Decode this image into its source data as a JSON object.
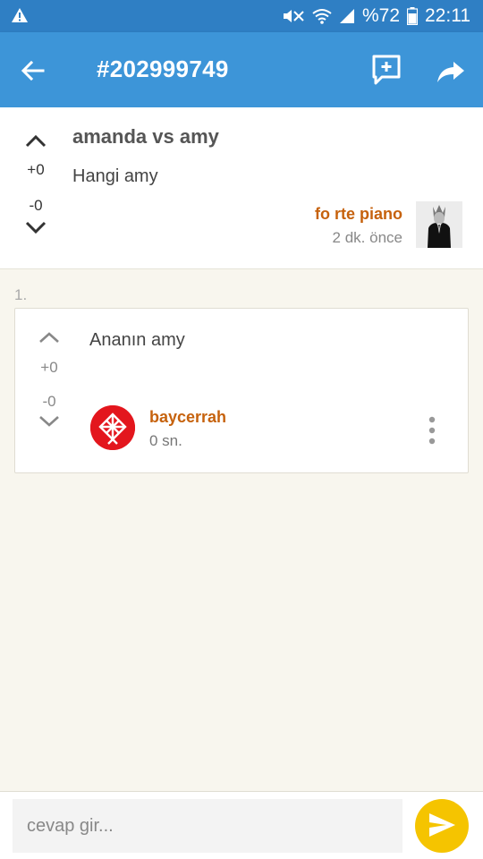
{
  "status_bar": {
    "battery": "%72",
    "time": "22:11",
    "icons": [
      "warning-icon",
      "mute-icon",
      "wifi-icon",
      "signal-icon",
      "battery-icon"
    ]
  },
  "app_bar": {
    "title": "#202999749",
    "icons": [
      "back-arrow-icon",
      "add-entry-icon",
      "share-icon"
    ]
  },
  "topic": {
    "title": "amanda vs amy",
    "body": "Hangi amy",
    "upvotes": "+0",
    "downvotes": "-0",
    "author": "fo rte piano",
    "time": "2 dk. önce"
  },
  "entries": [
    {
      "index": "1.",
      "body": "Ananın amy",
      "upvotes": "+0",
      "downvotes": "-0",
      "author": "baycerrah",
      "time": "0 sn."
    }
  ],
  "composer": {
    "placeholder": "cevap gir...",
    "value": ""
  },
  "colors": {
    "app_bar": "#3d95d8",
    "status_bar": "#2f7fc4",
    "author": "#c6620d",
    "send_button": "#f5c400",
    "background": "#f8f6ee"
  }
}
